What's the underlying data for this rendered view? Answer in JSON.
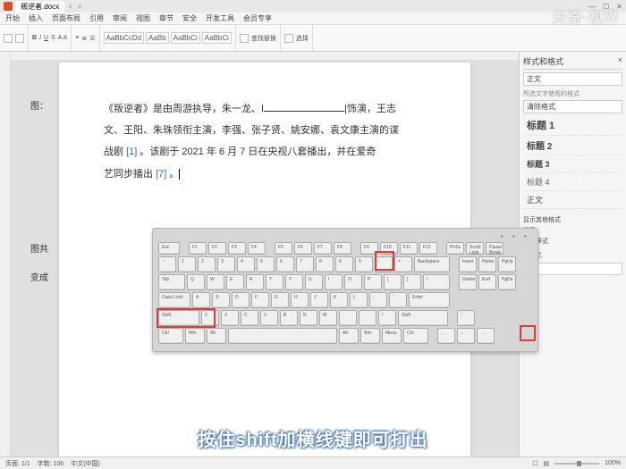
{
  "titlebar": {
    "tab": "叛逆者.docx",
    "plus": "+"
  },
  "menu": {
    "items": [
      "开始",
      "插入",
      "页面布局",
      "引用",
      "审阅",
      "视图",
      "章节",
      "安全",
      "开发工具",
      "会员专享"
    ]
  },
  "ribbon": {
    "styles": [
      "AaBbCcDd",
      "AaBb",
      "AaBbCi",
      "AaBbCi"
    ],
    "find": "查找替换",
    "select": "选择"
  },
  "doc": {
    "side1": "图：",
    "p1_a": "《叛逆者》是由周游执导，朱",
    "p1_b": "一龙、I",
    "p1_c": "|饰演，王志",
    "p2": "文、王阳、朱珠领衔主演，李强、张子贤、姚安娜、袁文康主演的谍",
    "p3_a": "战剧 ",
    "p3_ref1": "[1]",
    "p3_b": " 。该剧于 2021 年 6 月 7 日在央视八套播出，并在爱奇",
    "p4_a": "艺同步播出 ",
    "p4_ref2": "[7]",
    "p4_b": " 。",
    "side2": "图共",
    "side3": "变成"
  },
  "panel": {
    "title": "样式和格式",
    "current": "正文",
    "label1": "所选文字使用的格式",
    "clear": "清除格式",
    "styles": {
      "h1": "标题 1",
      "h2": "标题 2",
      "h3": "标题 3",
      "h4": "标题 4",
      "normal": "正文"
    },
    "sect": "显示其他格式",
    "f1": "显示",
    "f2": "有效样式",
    "new": "新样式",
    "body": "正文"
  },
  "status": {
    "page": "页面: 1/1",
    "words": "字数: 106",
    "lang": "中文(中国)",
    "zoom": "100%"
  },
  "kb": {
    "row0": [
      "Esc",
      "F1",
      "F2",
      "F3",
      "F4",
      "F5",
      "F6",
      "F7",
      "F8",
      "F9",
      "F10",
      "F11",
      "F12",
      "PrtSc",
      "Scroll Lock",
      "Pause Break"
    ],
    "row1": [
      "~",
      "1",
      "2",
      "3",
      "4",
      "5",
      "6",
      "7",
      "8",
      "9",
      "0",
      "-",
      "=",
      "Backspace",
      "Insert",
      "Home",
      "PgUp"
    ],
    "row2": [
      "Tab",
      "Q",
      "W",
      "E",
      "R",
      "T",
      "Y",
      "U",
      "I",
      "O",
      "P",
      "[",
      "]",
      "\\",
      "Delete",
      "End",
      "PgDn"
    ],
    "row3": [
      "Caps Lock",
      "A",
      "S",
      "D",
      "F",
      "G",
      "H",
      "J",
      "K",
      "L",
      ";",
      "'",
      "Enter"
    ],
    "row4": [
      "Shift",
      "Z",
      "X",
      "C",
      "V",
      "B",
      "N",
      "M",
      ",",
      ".",
      "/",
      "Shift",
      "↑"
    ],
    "row5": [
      "Ctrl",
      "Win",
      "Alt",
      "",
      "Alt",
      "Win",
      "Menu",
      "Ctrl",
      "←",
      "↓",
      "→"
    ]
  },
  "watermark": "天奇·视界",
  "subtitle": "按住shift加横线键即可打出"
}
